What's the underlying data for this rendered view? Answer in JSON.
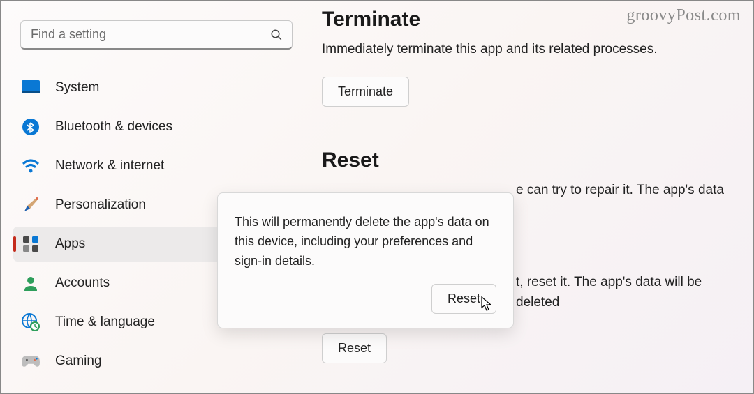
{
  "watermark": "groovyPost.com",
  "search": {
    "placeholder": "Find a setting"
  },
  "sidebar": {
    "items": [
      {
        "label": "System"
      },
      {
        "label": "Bluetooth & devices"
      },
      {
        "label": "Network & internet"
      },
      {
        "label": "Personalization"
      },
      {
        "label": "Apps"
      },
      {
        "label": "Accounts"
      },
      {
        "label": "Time & language"
      },
      {
        "label": "Gaming"
      }
    ]
  },
  "main": {
    "terminate": {
      "heading": "Terminate",
      "desc": "Immediately terminate this app and its related processes.",
      "button": "Terminate"
    },
    "reset": {
      "heading": "Reset",
      "repair_desc_fragment": "e can try to repair it. The app's data",
      "reset_desc_fragment": "t, reset it. The app's data will be deleted",
      "button": "Reset"
    }
  },
  "popup": {
    "text": "This will permanently delete the app's data on this device, including your preferences and sign-in details.",
    "confirm": "Reset"
  }
}
